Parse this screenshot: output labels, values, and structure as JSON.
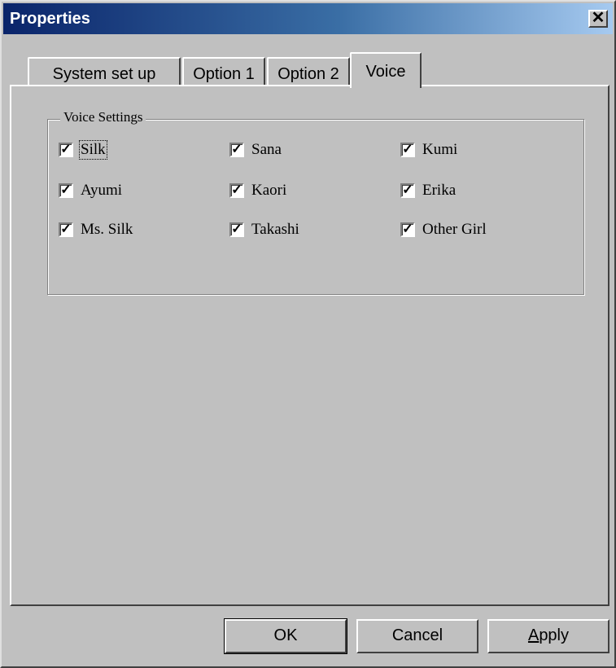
{
  "window": {
    "title": "Properties",
    "close_icon": "close-icon"
  },
  "tabs": [
    {
      "label": "System set up",
      "active": false
    },
    {
      "label": "Option 1",
      "active": false
    },
    {
      "label": "Option 2",
      "active": false
    },
    {
      "label": "Voice",
      "active": true
    }
  ],
  "voice_settings": {
    "title": "Voice Settings",
    "checkboxes": [
      {
        "label": "Silk",
        "checked": true,
        "focused": true
      },
      {
        "label": "Sana",
        "checked": true
      },
      {
        "label": "Kumi",
        "checked": true
      },
      {
        "label": "Ayumi",
        "checked": true
      },
      {
        "label": "Kaori",
        "checked": true
      },
      {
        "label": "Erika",
        "checked": true
      },
      {
        "label": "Ms. Silk",
        "checked": true
      },
      {
        "label": "Takashi",
        "checked": true
      },
      {
        "label": "Other Girl",
        "checked": true
      }
    ]
  },
  "buttons": {
    "ok": "OK",
    "cancel": "Cancel",
    "apply": "Apply"
  }
}
